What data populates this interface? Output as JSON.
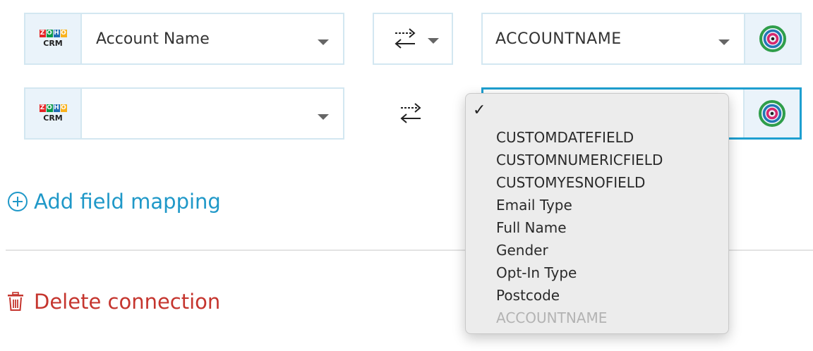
{
  "mappings": [
    {
      "source": {
        "logo": {
          "letters": [
            "Z",
            "O",
            "H",
            "O"
          ],
          "colors": [
            "#e42527",
            "#089949",
            "#226db4",
            "#f9b21d"
          ],
          "sublabel": "CRM"
        },
        "value": "Account Name"
      },
      "direction_icon": "bidirectional-arrows-icon",
      "destination": {
        "value": "ACCOUNTNAME",
        "logo_icon": "target-rings-icon"
      }
    },
    {
      "source": {
        "logo": {
          "letters": [
            "Z",
            "O",
            "H",
            "O"
          ],
          "colors": [
            "#e42527",
            "#089949",
            "#226db4",
            "#f9b21d"
          ],
          "sublabel": "CRM"
        },
        "value": ""
      },
      "direction_icon": "bidirectional-arrows-icon",
      "destination": {
        "value": "",
        "logo_icon": "target-rings-icon"
      }
    }
  ],
  "add_mapping": {
    "label": "Add field mapping",
    "icon": "plus-circle-icon",
    "color": "#1f98c8"
  },
  "delete_connection": {
    "label": "Delete connection",
    "icon": "trash-icon",
    "color": "#c5352e"
  },
  "dropdown": {
    "selected_mark": "✓",
    "options": [
      {
        "label": "CUSTOMDATEFIELD",
        "disabled": false
      },
      {
        "label": "CUSTOMNUMERICFIELD",
        "disabled": false
      },
      {
        "label": "CUSTOMYESNOFIELD",
        "disabled": false
      },
      {
        "label": "Email Type",
        "disabled": false
      },
      {
        "label": "Full Name",
        "disabled": false
      },
      {
        "label": "Gender",
        "disabled": false
      },
      {
        "label": "Opt-In Type",
        "disabled": false
      },
      {
        "label": "Postcode",
        "disabled": false
      },
      {
        "label": "ACCOUNTNAME",
        "disabled": true
      }
    ]
  },
  "colors": {
    "accent": "#1e9fd0",
    "border": "#d3e7f1",
    "logo_bg": "#eaf3fa"
  }
}
